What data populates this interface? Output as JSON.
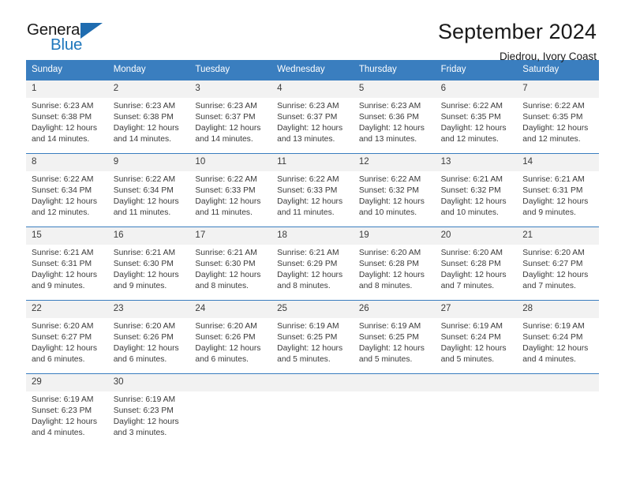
{
  "logo": {
    "primary_text": "General",
    "secondary_text": "Blue",
    "triangle_icon": "triangle-icon",
    "primary_color": "#1a1a1a",
    "secondary_color": "#1f77bc",
    "triangle_color": "#1f6cb0"
  },
  "header": {
    "month_title": "September 2024",
    "location": "Diedrou, Ivory Coast"
  },
  "colors": {
    "header_blue": "#3a7ebf",
    "daynum_strip": "#f2f2f2",
    "text": "#3a3a3a",
    "background": "#ffffff"
  },
  "weekdays": [
    "Sunday",
    "Monday",
    "Tuesday",
    "Wednesday",
    "Thursday",
    "Friday",
    "Saturday"
  ],
  "weeks": [
    {
      "days": [
        {
          "num": "1",
          "sunrise": "Sunrise: 6:23 AM",
          "sunset": "Sunset: 6:38 PM",
          "daylight1": "Daylight: 12 hours",
          "daylight2": "and 14 minutes."
        },
        {
          "num": "2",
          "sunrise": "Sunrise: 6:23 AM",
          "sunset": "Sunset: 6:38 PM",
          "daylight1": "Daylight: 12 hours",
          "daylight2": "and 14 minutes."
        },
        {
          "num": "3",
          "sunrise": "Sunrise: 6:23 AM",
          "sunset": "Sunset: 6:37 PM",
          "daylight1": "Daylight: 12 hours",
          "daylight2": "and 14 minutes."
        },
        {
          "num": "4",
          "sunrise": "Sunrise: 6:23 AM",
          "sunset": "Sunset: 6:37 PM",
          "daylight1": "Daylight: 12 hours",
          "daylight2": "and 13 minutes."
        },
        {
          "num": "5",
          "sunrise": "Sunrise: 6:23 AM",
          "sunset": "Sunset: 6:36 PM",
          "daylight1": "Daylight: 12 hours",
          "daylight2": "and 13 minutes."
        },
        {
          "num": "6",
          "sunrise": "Sunrise: 6:22 AM",
          "sunset": "Sunset: 6:35 PM",
          "daylight1": "Daylight: 12 hours",
          "daylight2": "and 12 minutes."
        },
        {
          "num": "7",
          "sunrise": "Sunrise: 6:22 AM",
          "sunset": "Sunset: 6:35 PM",
          "daylight1": "Daylight: 12 hours",
          "daylight2": "and 12 minutes."
        }
      ]
    },
    {
      "days": [
        {
          "num": "8",
          "sunrise": "Sunrise: 6:22 AM",
          "sunset": "Sunset: 6:34 PM",
          "daylight1": "Daylight: 12 hours",
          "daylight2": "and 12 minutes."
        },
        {
          "num": "9",
          "sunrise": "Sunrise: 6:22 AM",
          "sunset": "Sunset: 6:34 PM",
          "daylight1": "Daylight: 12 hours",
          "daylight2": "and 11 minutes."
        },
        {
          "num": "10",
          "sunrise": "Sunrise: 6:22 AM",
          "sunset": "Sunset: 6:33 PM",
          "daylight1": "Daylight: 12 hours",
          "daylight2": "and 11 minutes."
        },
        {
          "num": "11",
          "sunrise": "Sunrise: 6:22 AM",
          "sunset": "Sunset: 6:33 PM",
          "daylight1": "Daylight: 12 hours",
          "daylight2": "and 11 minutes."
        },
        {
          "num": "12",
          "sunrise": "Sunrise: 6:22 AM",
          "sunset": "Sunset: 6:32 PM",
          "daylight1": "Daylight: 12 hours",
          "daylight2": "and 10 minutes."
        },
        {
          "num": "13",
          "sunrise": "Sunrise: 6:21 AM",
          "sunset": "Sunset: 6:32 PM",
          "daylight1": "Daylight: 12 hours",
          "daylight2": "and 10 minutes."
        },
        {
          "num": "14",
          "sunrise": "Sunrise: 6:21 AM",
          "sunset": "Sunset: 6:31 PM",
          "daylight1": "Daylight: 12 hours",
          "daylight2": "and 9 minutes."
        }
      ]
    },
    {
      "days": [
        {
          "num": "15",
          "sunrise": "Sunrise: 6:21 AM",
          "sunset": "Sunset: 6:31 PM",
          "daylight1": "Daylight: 12 hours",
          "daylight2": "and 9 minutes."
        },
        {
          "num": "16",
          "sunrise": "Sunrise: 6:21 AM",
          "sunset": "Sunset: 6:30 PM",
          "daylight1": "Daylight: 12 hours",
          "daylight2": "and 9 minutes."
        },
        {
          "num": "17",
          "sunrise": "Sunrise: 6:21 AM",
          "sunset": "Sunset: 6:30 PM",
          "daylight1": "Daylight: 12 hours",
          "daylight2": "and 8 minutes."
        },
        {
          "num": "18",
          "sunrise": "Sunrise: 6:21 AM",
          "sunset": "Sunset: 6:29 PM",
          "daylight1": "Daylight: 12 hours",
          "daylight2": "and 8 minutes."
        },
        {
          "num": "19",
          "sunrise": "Sunrise: 6:20 AM",
          "sunset": "Sunset: 6:28 PM",
          "daylight1": "Daylight: 12 hours",
          "daylight2": "and 8 minutes."
        },
        {
          "num": "20",
          "sunrise": "Sunrise: 6:20 AM",
          "sunset": "Sunset: 6:28 PM",
          "daylight1": "Daylight: 12 hours",
          "daylight2": "and 7 minutes."
        },
        {
          "num": "21",
          "sunrise": "Sunrise: 6:20 AM",
          "sunset": "Sunset: 6:27 PM",
          "daylight1": "Daylight: 12 hours",
          "daylight2": "and 7 minutes."
        }
      ]
    },
    {
      "days": [
        {
          "num": "22",
          "sunrise": "Sunrise: 6:20 AM",
          "sunset": "Sunset: 6:27 PM",
          "daylight1": "Daylight: 12 hours",
          "daylight2": "and 6 minutes."
        },
        {
          "num": "23",
          "sunrise": "Sunrise: 6:20 AM",
          "sunset": "Sunset: 6:26 PM",
          "daylight1": "Daylight: 12 hours",
          "daylight2": "and 6 minutes."
        },
        {
          "num": "24",
          "sunrise": "Sunrise: 6:20 AM",
          "sunset": "Sunset: 6:26 PM",
          "daylight1": "Daylight: 12 hours",
          "daylight2": "and 6 minutes."
        },
        {
          "num": "25",
          "sunrise": "Sunrise: 6:19 AM",
          "sunset": "Sunset: 6:25 PM",
          "daylight1": "Daylight: 12 hours",
          "daylight2": "and 5 minutes."
        },
        {
          "num": "26",
          "sunrise": "Sunrise: 6:19 AM",
          "sunset": "Sunset: 6:25 PM",
          "daylight1": "Daylight: 12 hours",
          "daylight2": "and 5 minutes."
        },
        {
          "num": "27",
          "sunrise": "Sunrise: 6:19 AM",
          "sunset": "Sunset: 6:24 PM",
          "daylight1": "Daylight: 12 hours",
          "daylight2": "and 5 minutes."
        },
        {
          "num": "28",
          "sunrise": "Sunrise: 6:19 AM",
          "sunset": "Sunset: 6:24 PM",
          "daylight1": "Daylight: 12 hours",
          "daylight2": "and 4 minutes."
        }
      ]
    },
    {
      "days": [
        {
          "num": "29",
          "sunrise": "Sunrise: 6:19 AM",
          "sunset": "Sunset: 6:23 PM",
          "daylight1": "Daylight: 12 hours",
          "daylight2": "and 4 minutes."
        },
        {
          "num": "30",
          "sunrise": "Sunrise: 6:19 AM",
          "sunset": "Sunset: 6:23 PM",
          "daylight1": "Daylight: 12 hours",
          "daylight2": "and 3 minutes."
        },
        {
          "num": "",
          "sunrise": "",
          "sunset": "",
          "daylight1": "",
          "daylight2": ""
        },
        {
          "num": "",
          "sunrise": "",
          "sunset": "",
          "daylight1": "",
          "daylight2": ""
        },
        {
          "num": "",
          "sunrise": "",
          "sunset": "",
          "daylight1": "",
          "daylight2": ""
        },
        {
          "num": "",
          "sunrise": "",
          "sunset": "",
          "daylight1": "",
          "daylight2": ""
        },
        {
          "num": "",
          "sunrise": "",
          "sunset": "",
          "daylight1": "",
          "daylight2": ""
        }
      ]
    }
  ]
}
